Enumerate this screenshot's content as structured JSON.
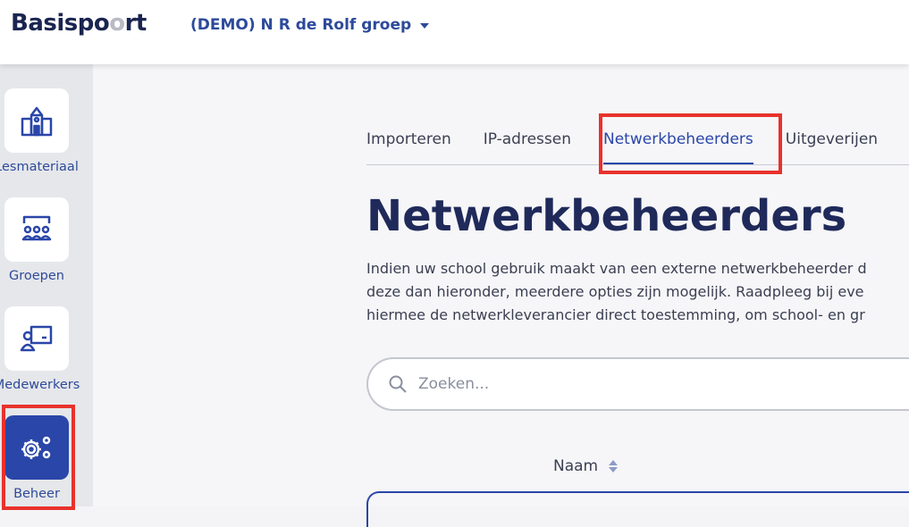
{
  "header": {
    "logo_part1": "Basispo",
    "logo_ring": "o",
    "logo_part2": "rt",
    "school_name": "(DEMO) N R de Rolf groep"
  },
  "sidebar": {
    "items": [
      {
        "label": "Lesmateriaal",
        "icon": "school-building-icon",
        "active": false
      },
      {
        "label": "Groepen",
        "icon": "group-board-icon",
        "active": false
      },
      {
        "label": "Medewerkers",
        "icon": "person-screen-icon",
        "active": false
      },
      {
        "label": "Beheer",
        "icon": "gears-icon",
        "active": true
      }
    ]
  },
  "tabs": [
    {
      "label": "Importeren",
      "active": false
    },
    {
      "label": "IP-adressen",
      "active": false
    },
    {
      "label": "Netwerkbeheerders",
      "active": true
    },
    {
      "label": "Uitgeverijen",
      "active": false
    }
  ],
  "main": {
    "title": "Netwerkbeheerders",
    "description_lines": [
      "Indien uw school gebruik maakt van een externe netwerkbeheerder d",
      "deze dan hieronder, meerdere opties zijn mogelijk. Raadpleeg bij eve",
      "hiermee de netwerkleverancier direct toestemming, om school- en gr"
    ],
    "search_placeholder": "Zoeken...",
    "column_header": "Naam"
  },
  "colors": {
    "accent": "#2a46a8",
    "highlight": "#e8322c",
    "text_dark": "#1f2a5a"
  }
}
